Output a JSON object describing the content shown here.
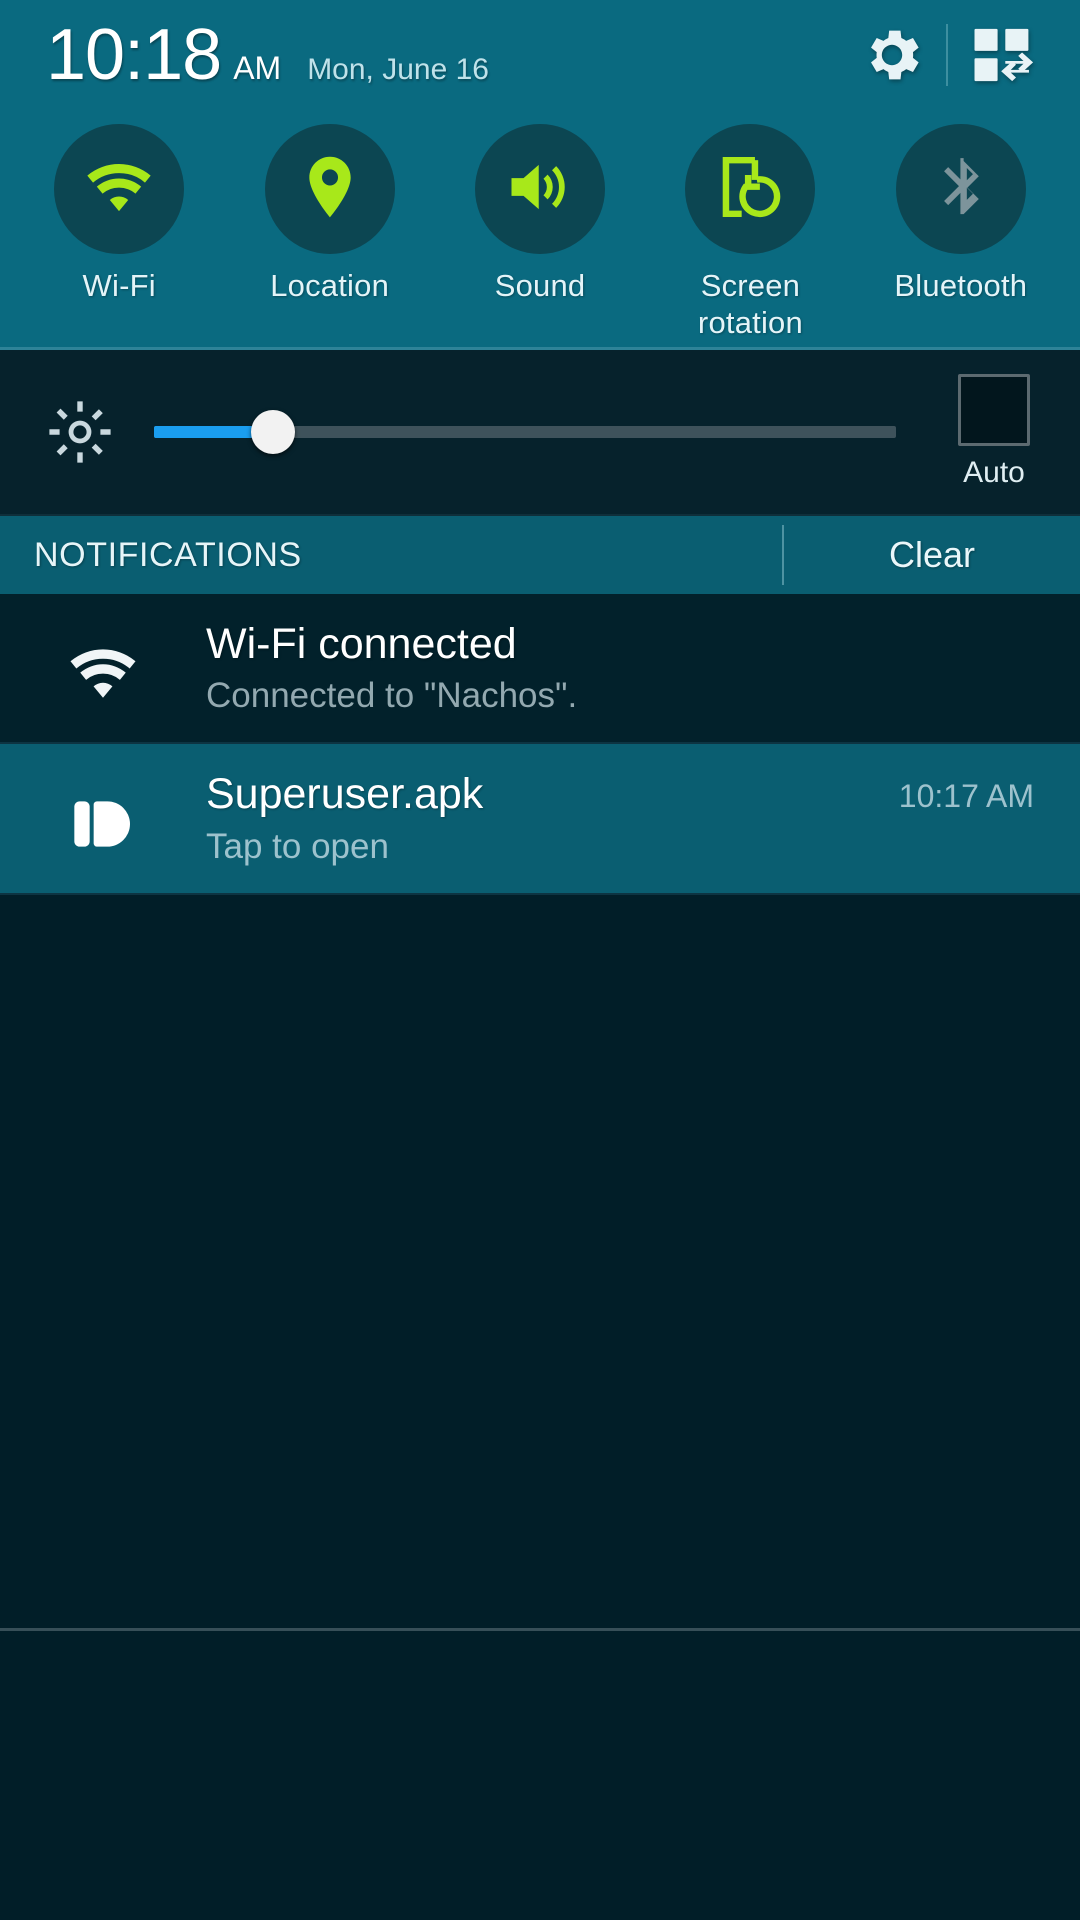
{
  "status_bar": {
    "time": "10:18",
    "ampm": "AM",
    "date": "Mon, June 16",
    "settings_icon": "gear-icon",
    "quick_settings_icon": "quick-settings-grid-icon"
  },
  "quick_settings": {
    "toggles": [
      {
        "label": "Wi-Fi",
        "icon": "wifi-icon",
        "state": "on",
        "color": "#a8e81a"
      },
      {
        "label": "Location",
        "icon": "location-pin-icon",
        "state": "on",
        "color": "#a8e81a"
      },
      {
        "label": "Sound",
        "icon": "speaker-sound-icon",
        "state": "on",
        "color": "#a8e81a"
      },
      {
        "label": "Screen\nrotation",
        "icon": "screen-rotation-icon",
        "state": "on",
        "color": "#a8e81a"
      },
      {
        "label": "Bluetooth",
        "icon": "bluetooth-icon",
        "state": "off",
        "color": "#7d949b"
      }
    ]
  },
  "brightness": {
    "icon": "brightness-gear-icon",
    "value_percent": 16,
    "fill_color": "#1a9ef0",
    "auto_label": "Auto",
    "auto_checked": false
  },
  "notifications_header": {
    "title": "NOTIFICATIONS",
    "clear_label": "Clear"
  },
  "notifications": [
    {
      "icon": "wifi-icon",
      "title": "Wi-Fi connected",
      "subtitle": "Connected to \"Nachos\".",
      "time": "",
      "highlighted": false
    },
    {
      "icon": "pushbullet-icon",
      "title": "Superuser.apk",
      "subtitle": "Tap to open",
      "time": "10:17 AM",
      "highlighted": true
    }
  ],
  "theme": {
    "header_teal": "#0a6a80",
    "shade_dark": "#011e28",
    "accent_green": "#a8e81a",
    "slider_blue": "#1a9ef0",
    "highlight_teal": "#0a5e71"
  }
}
